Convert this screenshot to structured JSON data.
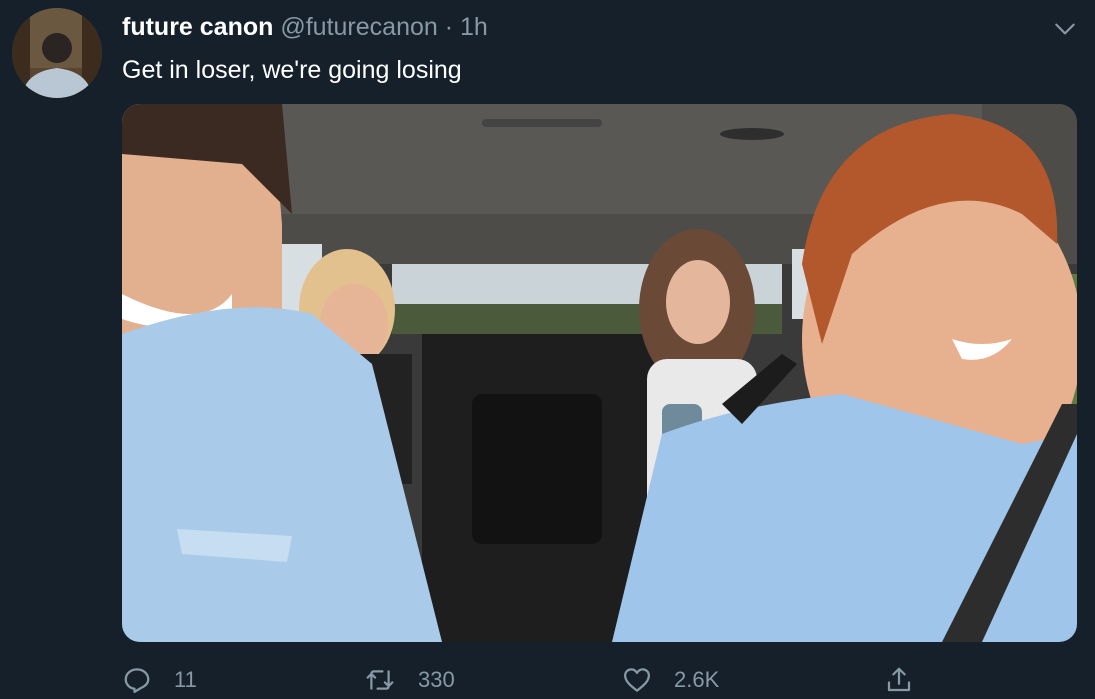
{
  "tweet": {
    "display_name": "future canon",
    "handle": "@futurecanon",
    "separator": "·",
    "time": "1h",
    "text": "Get in loser, we're going losing"
  },
  "actions": {
    "reply_count": "11",
    "retweet_count": "330",
    "like_count": "2.6K"
  },
  "icons": {
    "more": "chevron-down-icon",
    "reply": "reply-icon",
    "retweet": "retweet-icon",
    "like": "heart-icon",
    "share": "share-icon"
  },
  "colors": {
    "background": "#15202b",
    "secondary_text": "#8899a6",
    "primary_text": "#ffffff"
  }
}
